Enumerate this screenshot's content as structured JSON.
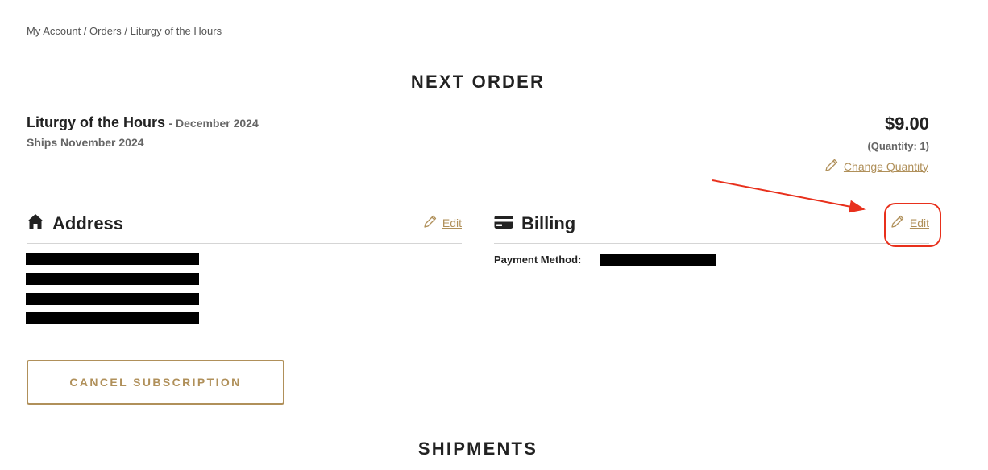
{
  "breadcrumb": {
    "items": [
      "My Account",
      "Orders",
      "Liturgy of the Hours"
    ],
    "separator": " / "
  },
  "next_order": {
    "title": "NEXT ORDER",
    "product_name": "Liturgy of the Hours",
    "product_date": "- December 2024",
    "ships": "Ships November 2024",
    "price": "$9.00",
    "quantity": "(Quantity: 1)",
    "change_quantity_label": "Change Quantity"
  },
  "address": {
    "title": "Address",
    "edit_label": "Edit",
    "icon": "home-icon"
  },
  "billing": {
    "title": "Billing",
    "edit_label": "Edit",
    "icon": "credit-card-icon",
    "payment_method_label": "Payment Method:"
  },
  "actions": {
    "cancel_label": "CANCEL SUBSCRIPTION"
  },
  "shipments": {
    "title": "SHIPMENTS"
  },
  "colors": {
    "accent": "#b0905a",
    "annotation": "#e8301c",
    "text": "#222222",
    "muted": "#666666",
    "divider": "#d5d5d5"
  }
}
